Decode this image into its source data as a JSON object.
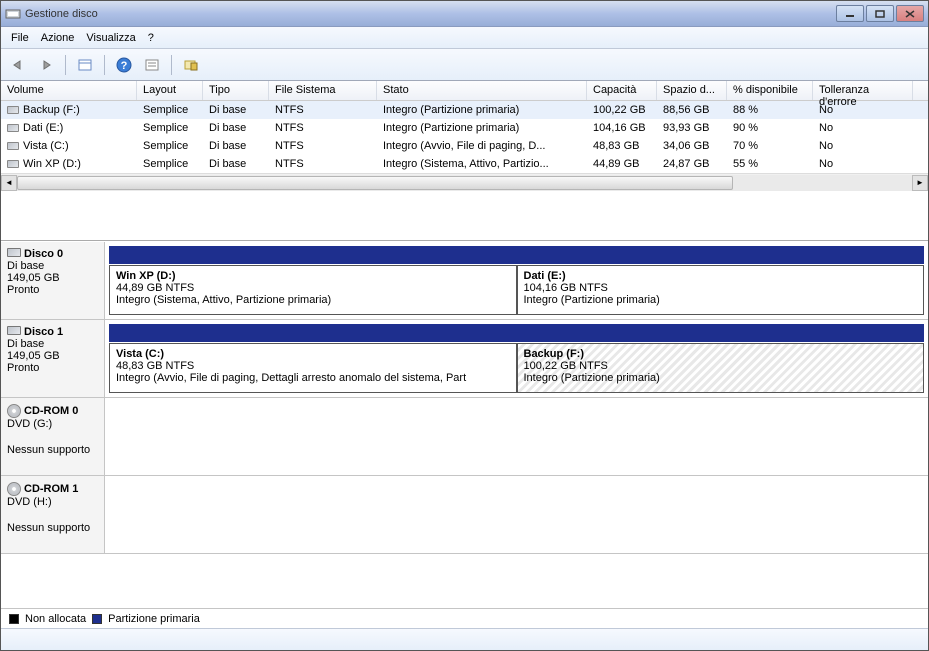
{
  "window": {
    "title": "Gestione disco"
  },
  "menu": {
    "items": [
      "File",
      "Azione",
      "Visualizza",
      "?"
    ]
  },
  "columns": [
    "Volume",
    "Layout",
    "Tipo",
    "File Sistema",
    "Stato",
    "Capacità",
    "Spazio d...",
    "% disponibile",
    "Tolleranza d'errore"
  ],
  "volumes": [
    {
      "name": "Backup (F:)",
      "layout": "Semplice",
      "tipo": "Di base",
      "fs": "NTFS",
      "stato": "Integro (Partizione primaria)",
      "cap": "100,22 GB",
      "free": "88,56 GB",
      "pct": "88 %",
      "tol": "No",
      "selected": true
    },
    {
      "name": "Dati (E:)",
      "layout": "Semplice",
      "tipo": "Di base",
      "fs": "NTFS",
      "stato": "Integro (Partizione primaria)",
      "cap": "104,16 GB",
      "free": "93,93 GB",
      "pct": "90 %",
      "tol": "No"
    },
    {
      "name": "Vista (C:)",
      "layout": "Semplice",
      "tipo": "Di base",
      "fs": "NTFS",
      "stato": "Integro (Avvio, File di paging, D...",
      "cap": "48,83 GB",
      "free": "34,06 GB",
      "pct": "70 %",
      "tol": "No"
    },
    {
      "name": "Win XP (D:)",
      "layout": "Semplice",
      "tipo": "Di base",
      "fs": "NTFS",
      "stato": "Integro (Sistema, Attivo, Partizio...",
      "cap": "44,89 GB",
      "free": "24,87 GB",
      "pct": "55 %",
      "tol": "No"
    }
  ],
  "disks": [
    {
      "name": "Disco 0",
      "type": "Di base",
      "size": "149,05 GB",
      "status": "Pronto",
      "kind": "disk",
      "partitions": [
        {
          "name": "Win XP  (D:)",
          "size": "44,89 GB NTFS",
          "status": "Integro (Sistema, Attivo, Partizione primaria)"
        },
        {
          "name": "Dati  (E:)",
          "size": "104,16 GB NTFS",
          "status": "Integro (Partizione primaria)"
        }
      ]
    },
    {
      "name": "Disco 1",
      "type": "Di base",
      "size": "149,05 GB",
      "status": "Pronto",
      "kind": "disk",
      "partitions": [
        {
          "name": "Vista  (C:)",
          "size": "48,83 GB NTFS",
          "status": "Integro (Avvio, File di paging, Dettagli arresto anomalo del sistema, Part"
        },
        {
          "name": "Backup  (F:)",
          "size": "100,22 GB NTFS",
          "status": "Integro (Partizione primaria)",
          "hatched": true
        }
      ]
    },
    {
      "name": "CD-ROM 0",
      "type": "DVD (G:)",
      "size": "",
      "status": "Nessun supporto",
      "kind": "cd",
      "partitions": []
    },
    {
      "name": "CD-ROM 1",
      "type": "DVD (H:)",
      "size": "",
      "status": "Nessun supporto",
      "kind": "cd",
      "partitions": []
    }
  ],
  "legend": {
    "unallocated": "Non allocata",
    "primary": "Partizione primaria"
  }
}
